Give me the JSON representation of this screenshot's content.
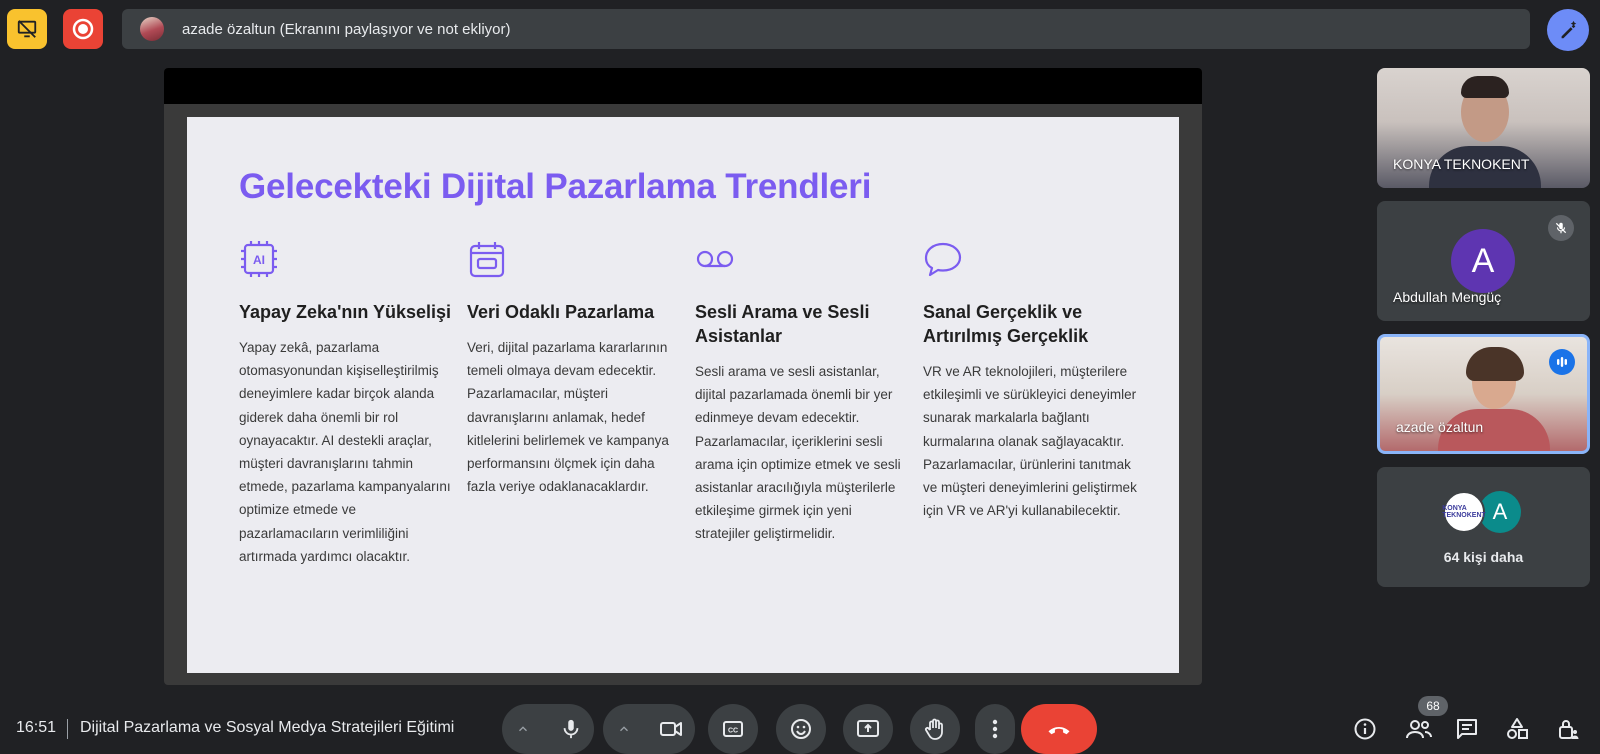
{
  "top_bar": {
    "presenter_banner": "azade özaltun (Ekranını paylaşıyor ve not ekliyor)"
  },
  "slide": {
    "title": "Gelecekteki Dijital Pazarlama Trendleri",
    "accent_color": "#7b5cf0",
    "columns": [
      {
        "icon": "ai-chip-icon",
        "heading": "Yapay Zeka'nın Yükselişi",
        "body": "Yapay zekâ, pazarlama otomasyonundan kişiselleştirilmiş deneyimlere kadar birçok alanda giderek daha önemli bir rol oynayacaktır. AI destekli araçlar, müşteri davranışlarını tahmin etmede, pazarlama kampanyalarını optimize etmede ve pazarlamacıların verimliliğini artırmada yardımcı olacaktır."
      },
      {
        "icon": "data-calendar-icon",
        "heading": "Veri Odaklı Pazarlama",
        "body": "Veri, dijital pazarlama kararlarının temeli olmaya devam edecektir. Pazarlamacılar, müşteri davranışlarını anlamak, hedef kitlelerini belirlemek ve kampanya performansını ölçmek için daha fazla veriye odaklanacaklardır."
      },
      {
        "icon": "voicemail-icon",
        "heading": "Sesli Arama ve Sesli\nAsistanlar",
        "body": "Sesli arama ve sesli asistanlar, dijital pazarlamada önemli bir yer edinmeye devam edecektir. Pazarlamacılar, içeriklerini sesli arama için optimize etmek ve sesli asistanlar aracılığıyla müşterilerle etkileşime girmek için yeni stratejiler geliştirmelidir."
      },
      {
        "icon": "speech-bubble-icon",
        "heading": "Sanal Gerçeklik ve\nArtırılmış Gerçeklik",
        "body": "VR ve AR teknolojileri, müşterilere etkileşimli ve sürükleyici deneyimler sunarak markalarla bağlantı kurmalarına olanak sağlayacaktır. Pazarlamacılar, ürünlerini tanıtmak ve müşteri deneyimlerini geliştirmek için VR ve AR'yi kullanabilecektir."
      }
    ]
  },
  "participants": [
    {
      "name": "KONYA TEKNOKENT",
      "type": "video"
    },
    {
      "name": "Abdullah Mengüç",
      "avatar_letter": "A",
      "muted": true
    },
    {
      "name": "azade özaltun",
      "type": "video",
      "speaking": true
    }
  ],
  "more_participants": {
    "logo_text": "KONYA TEKNOKENT",
    "avatar_letter": "A",
    "label": "64 kişi daha"
  },
  "bottom_bar": {
    "time": "16:51",
    "meeting_title": "Dijital Pazarlama ve Sosyal Medya Stratejileri Eğitimi",
    "participant_count": "68"
  },
  "colors": {
    "end_call": "#ea4335",
    "speaking_border": "#8ab4f8"
  }
}
